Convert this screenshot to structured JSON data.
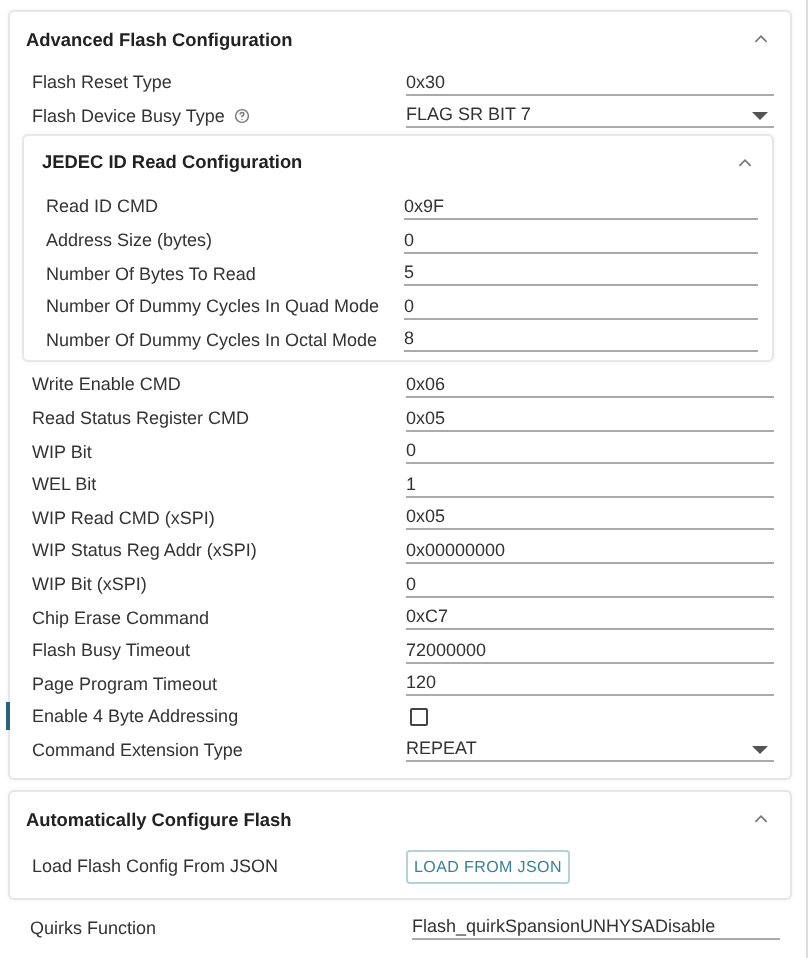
{
  "advanced": {
    "title": "Advanced Flash Configuration",
    "expanded": true,
    "rows_top": [
      {
        "kind": "text",
        "label": "Flash Reset Type",
        "value": "0x30"
      },
      {
        "kind": "select",
        "label": "Flash Device Busy Type",
        "value": "FLAG SR BIT 7",
        "help": true
      }
    ],
    "jedec": {
      "title": "JEDEC ID Read Configuration",
      "expanded": true,
      "rows": [
        {
          "label": "Read ID CMD",
          "value": "0x9F"
        },
        {
          "label": "Address Size (bytes)",
          "value": "0"
        },
        {
          "label": "Number Of Bytes To Read",
          "value": "5"
        },
        {
          "label": "Number Of Dummy Cycles In Quad Mode",
          "value": "0"
        },
        {
          "label": "Number Of Dummy Cycles In Octal Mode",
          "value": "8"
        }
      ]
    },
    "rows_bottom": [
      {
        "kind": "text",
        "label": "Write Enable CMD",
        "value": "0x06"
      },
      {
        "kind": "text",
        "label": "Read Status Register CMD",
        "value": "0x05"
      },
      {
        "kind": "text",
        "label": "WIP Bit",
        "value": "0"
      },
      {
        "kind": "text",
        "label": "WEL Bit",
        "value": "1"
      },
      {
        "kind": "text",
        "label": "WIP Read CMD (xSPI)",
        "value": "0x05"
      },
      {
        "kind": "text",
        "label": "WIP Status Reg Addr (xSPI)",
        "value": "0x00000000"
      },
      {
        "kind": "text",
        "label": "WIP Bit (xSPI)",
        "value": "0"
      },
      {
        "kind": "text",
        "label": "Chip Erase Command",
        "value": "0xC7"
      },
      {
        "kind": "text",
        "label": "Flash Busy Timeout",
        "value": "72000000"
      },
      {
        "kind": "text",
        "label": "Page Program Timeout",
        "value": "120"
      },
      {
        "kind": "checkbox",
        "label": "Enable 4 Byte Addressing",
        "checked": false,
        "focused": true
      },
      {
        "kind": "select",
        "label": "Command Extension Type",
        "value": "REPEAT"
      }
    ]
  },
  "auto": {
    "title": "Automatically Configure Flash",
    "expanded": true,
    "rows": [
      {
        "kind": "button",
        "label": "Load Flash Config From JSON",
        "value": "LOAD FROM JSON"
      }
    ]
  },
  "quirks": {
    "label": "Quirks Function",
    "value": "Flash_quirkSpansionUNHYSADisable"
  }
}
